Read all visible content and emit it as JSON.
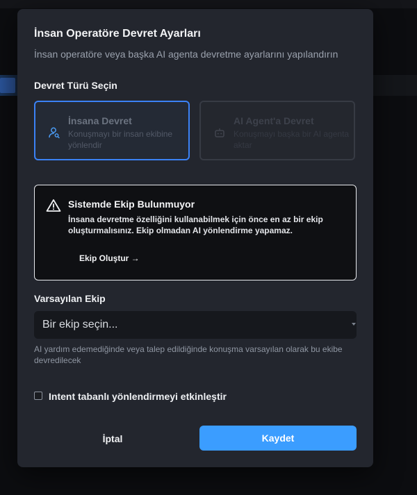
{
  "modal": {
    "title": "İnsan Operatöre Devret Ayarları",
    "subtitle": "İnsan operatöre veya başka AI agenta devretme ayarlarını yapılandırın"
  },
  "handoff_type": {
    "label": "Devret Türü Seçin",
    "options": [
      {
        "title": "İnsana Devret",
        "description": "Konuşmayı bir insan ekibine yönlendir",
        "icon": "user-search-icon",
        "selected": true
      },
      {
        "title": "AI Agent'a Devret",
        "description": "Konuşmayı başka bir AI agenta aktar",
        "icon": "bot-icon",
        "selected": false
      }
    ]
  },
  "alert": {
    "title": "Sistemde Ekip Bulunmuyor",
    "description": "İnsana devretme özelliğini kullanabilmek için önce en az bir ekip oluşturmalısınız. Ekip olmadan AI yönlendirme yapamaz.",
    "action": "Ekip Oluştur →",
    "icon": "warning-icon"
  },
  "default_team": {
    "label": "Varsayılan Ekip",
    "placeholder": "Bir ekip seçin...",
    "help": "AI yardım edemediğinde veya talep edildiğinde konuşma varsayılan olarak bu ekibe devredilecek"
  },
  "intent_routing": {
    "label": "Intent tabanlı yönlendirmeyi etkinleştir",
    "checked": false
  },
  "buttons": {
    "cancel": "İptal",
    "save": "Kaydet"
  },
  "colors": {
    "accent": "#3b82f6",
    "save_button": "#3b9dff",
    "modal_bg": "#23262e"
  }
}
